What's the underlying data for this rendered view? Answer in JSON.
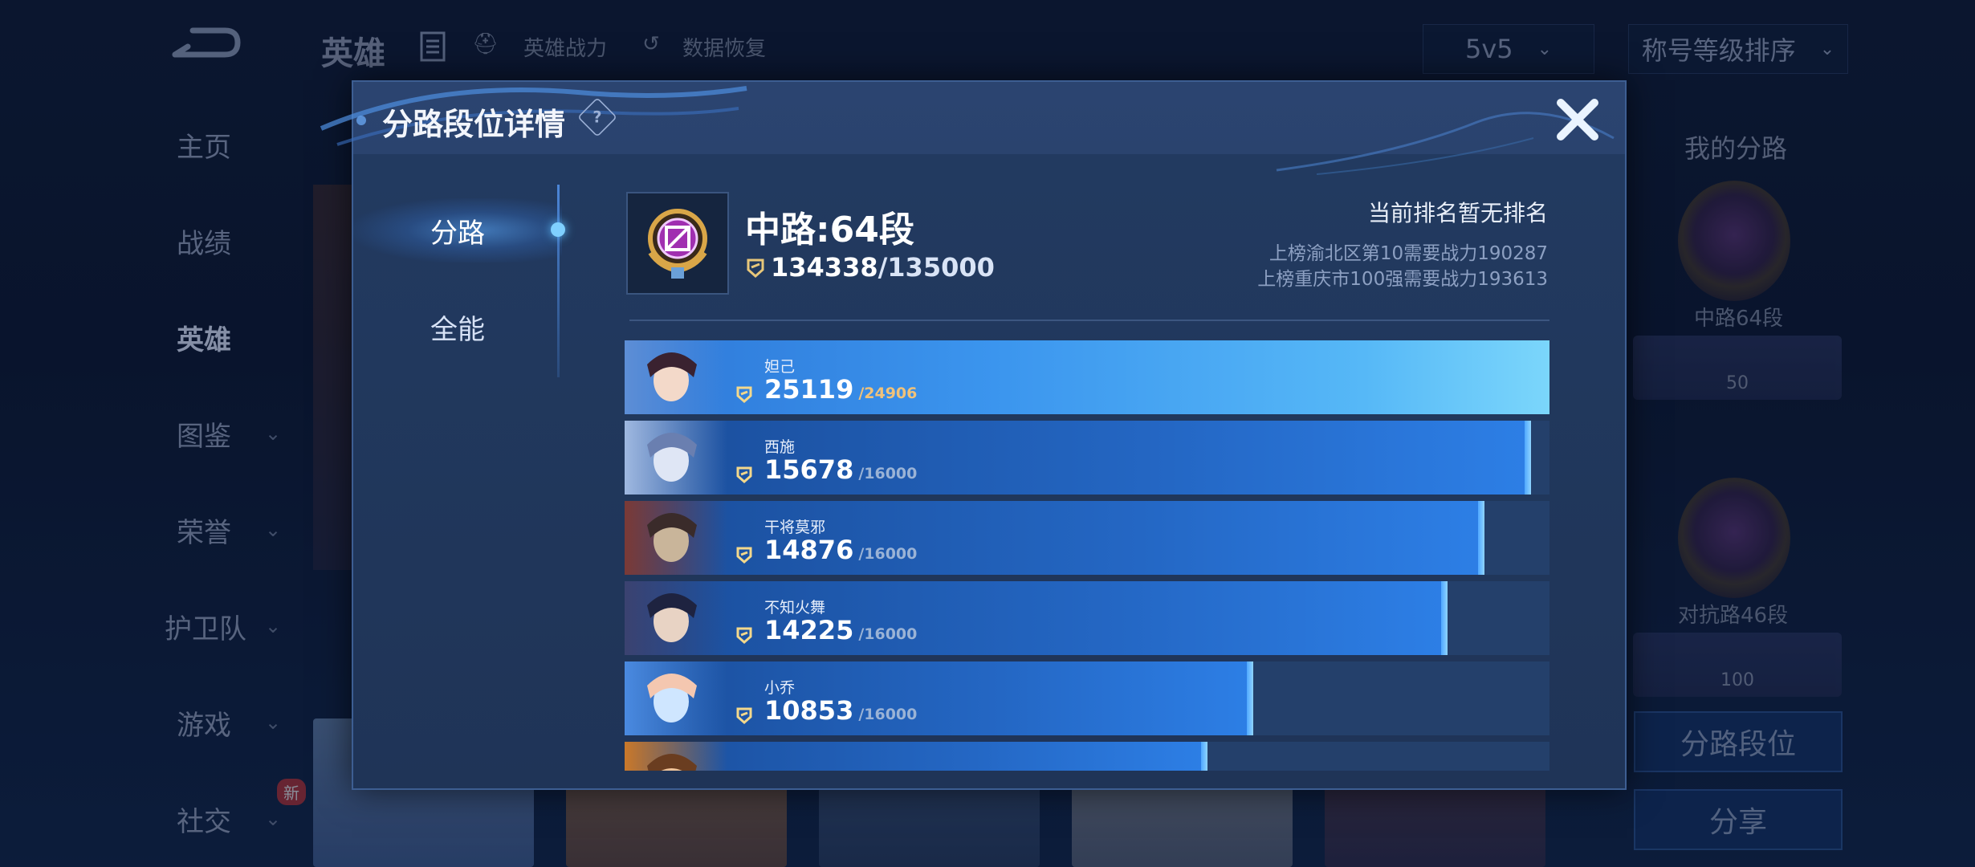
{
  "background": {
    "top_title": "英雄",
    "top_links": [
      "英雄战力",
      "数据恢复"
    ],
    "mode_dropdown": "5v5",
    "sort_dropdown": "称号等级排序",
    "nav": [
      {
        "label": "主页"
      },
      {
        "label": "战绩"
      },
      {
        "label": "英雄"
      },
      {
        "label": "图鉴"
      },
      {
        "label": "荣誉"
      },
      {
        "label": "护卫队"
      },
      {
        "label": "游戏"
      },
      {
        "label": "社交"
      }
    ],
    "new_badge": "新",
    "right_panel": {
      "title": "我的分路",
      "rank1_caption": "中路64段",
      "rank1_level": "50",
      "rank2_caption": "对抗路46段",
      "rank2_level": "100",
      "btn_lane_rank": "分路段位",
      "btn_share": "分享"
    }
  },
  "modal": {
    "title": "分路段位详情",
    "help": "?",
    "tabs": [
      {
        "label": "分路",
        "active": true
      },
      {
        "label": "全能",
        "active": false
      }
    ],
    "rank": {
      "title": "中路:64段",
      "score": "134338",
      "score_total": "/135000",
      "status": "当前排名暂无排名",
      "req1": "上榜渝北区第10需要战力190287",
      "req2": "上榜重庆市100强需要战力193613"
    },
    "heroes": [
      {
        "name": "妲己",
        "power": "25119",
        "max": "/24906",
        "fill": 1.0
      },
      {
        "name": "西施",
        "power": "15678",
        "max": "/16000",
        "fill": 0.98
      },
      {
        "name": "干将莫邪",
        "power": "14876",
        "max": "/16000",
        "fill": 0.93
      },
      {
        "name": "不知火舞",
        "power": "14225",
        "max": "/16000",
        "fill": 0.89
      },
      {
        "name": "小乔",
        "power": "10853",
        "max": "/16000",
        "fill": 0.68
      },
      {
        "name": "",
        "power": "",
        "max": "",
        "fill": 0.63
      }
    ]
  },
  "colors": {
    "accent": "#2d7fe6",
    "modal_bg": "#223a60",
    "gold": "#f0c27a"
  }
}
